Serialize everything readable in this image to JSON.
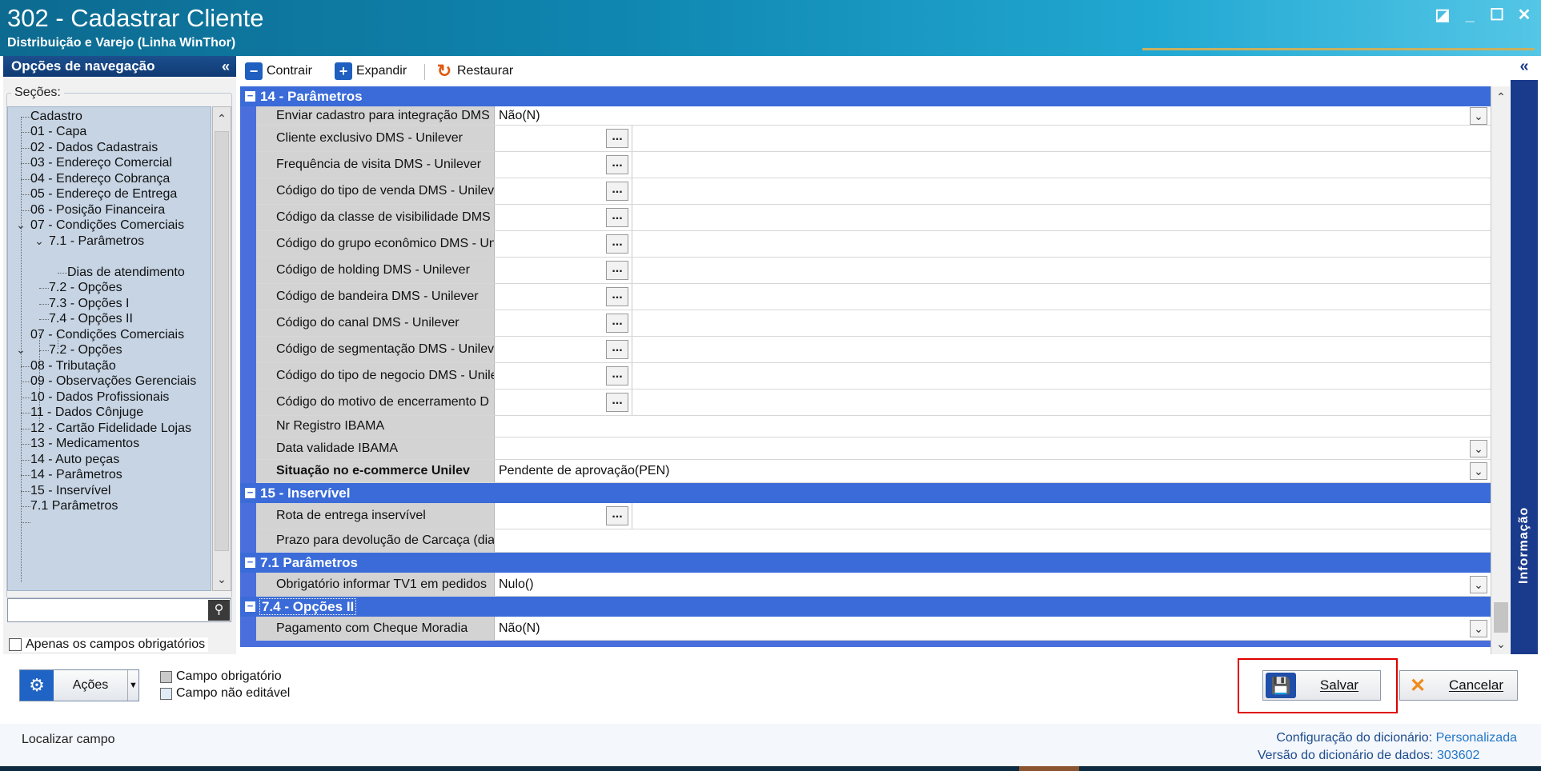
{
  "window": {
    "title": "302 - Cadastrar Cliente",
    "subtitle": "Distribuição e Varejo (Linha WinThor)",
    "buttons": [
      "◪",
      "_",
      "☐",
      "✕"
    ]
  },
  "nav": {
    "header": "Opções de navegação",
    "collapse_glyph": "«",
    "sections_label": "Seções:",
    "tree": [
      "Cadastro",
      "01 - Capa",
      "02 - Dados Cadastrais",
      "03 - Endereço Comercial",
      "04 - Endereço Cobrança",
      "05 - Endereço de Entrega",
      "06 - Posição Financeira",
      "07 - Condições Comerciais",
      "7.1 - Parâmetros",
      "Dias de atendimento",
      "7.2 - Opções",
      "7.3 - Opções I",
      "7.4 - Opções II",
      "07 - Condições Comerciais",
      "7.2 - Opções",
      "08 - Tributação",
      "09 - Observações Gerenciais",
      "10 - Dados Profissionais",
      "11 - Dados Cônjuge",
      "12 - Cartão Fidelidade Lojas",
      "13 - Medicamentos",
      "14 - Auto peças",
      "14 - Parâmetros",
      "15 - Inservível",
      "7.1 Parâmetros"
    ],
    "search_value": "",
    "only_required_label": "Apenas os campos obrigatórios"
  },
  "toolbar": {
    "contract": "Contrair",
    "expand": "Expandir",
    "restore": "Restaurar"
  },
  "grid": {
    "sections": [
      {
        "title": "14 - Parâmetros"
      },
      {
        "title": "15 - Inservível"
      },
      {
        "title": "7.1 Parâmetros"
      },
      {
        "title": "7.4 - Opções II"
      }
    ],
    "rows": [
      {
        "label": "Enviar cadastro para integração DMS",
        "value": "Não(N)"
      },
      {
        "label": "Cliente exclusivo DMS - Unilever",
        "value": ""
      },
      {
        "label": "Frequência de visita DMS - Unilever",
        "value": ""
      },
      {
        "label": "Código do tipo de venda DMS - Unilev",
        "value": ""
      },
      {
        "label": "Código da classe de visibilidade DMS -",
        "value": ""
      },
      {
        "label": "Código do grupo econômico DMS - Un",
        "value": ""
      },
      {
        "label": "Código de holding DMS - Unilever",
        "value": ""
      },
      {
        "label": "Código de bandeira DMS - Unilever",
        "value": ""
      },
      {
        "label": "Código do canal DMS - Unilever",
        "value": ""
      },
      {
        "label": "Código de segmentação DMS - Unilev",
        "value": ""
      },
      {
        "label": "Código do tipo de negocio DMS - Unile",
        "value": ""
      },
      {
        "label": "Código do motivo de encerramento D",
        "value": ""
      },
      {
        "label": "Nr Registro IBAMA",
        "value": ""
      },
      {
        "label": "Data validade IBAMA",
        "value": ""
      },
      {
        "label": "Situação no e-commerce Unilev",
        "value": "Pendente de aprovação(PEN)"
      },
      {
        "label": "Rota de entrega inservível",
        "value": ""
      },
      {
        "label": "Prazo para devolução de Carcaça (dia",
        "value": ""
      },
      {
        "label": "Obrigatório informar TV1 em pedidos",
        "value": "Nulo()"
      },
      {
        "label": "Pagamento com Cheque Moradia",
        "value": "Não(N)"
      }
    ],
    "ellipsis": "...",
    "dropdown_glyph": "⌄",
    "collapse_glyph": "−"
  },
  "side_panel": {
    "label": "Informação",
    "collapse_glyph": "«"
  },
  "bottom": {
    "actions_label": "Ações",
    "legend_required": "Campo obrigatório",
    "legend_noneditable": "Campo não editável",
    "save": "Salvar",
    "cancel": "Cancelar",
    "locate_field": "Localizar campo",
    "dict_config_label": "Configuração do dicionário:",
    "dict_config_value": "Personalizada",
    "dict_version_label": "Versão do dicionário de dados:",
    "dict_version_value": "303602"
  },
  "colors": {
    "title_bar": "#0f86b0",
    "section_header": "#3a6bd8",
    "nav_header": "#1c4f8e",
    "highlight": "#e00000"
  }
}
